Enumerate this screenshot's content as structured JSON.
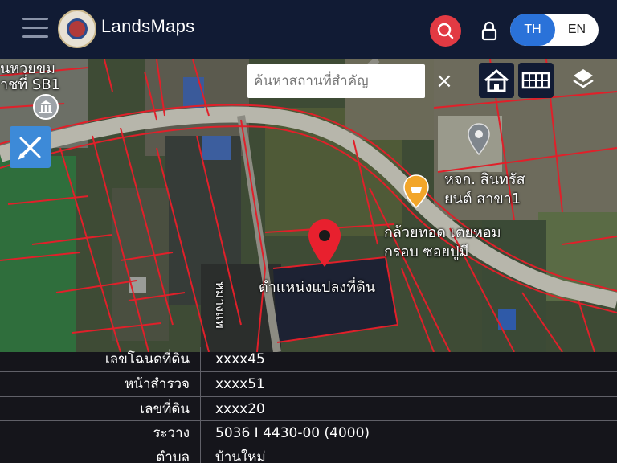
{
  "header": {
    "app_title": "LandsMaps",
    "lang_th": "TH",
    "lang_en": "EN",
    "active_lang": "TH"
  },
  "map": {
    "search_placeholder": "ค้นหาสถานที่สำคัญ",
    "search_value": "",
    "close_glyph": "×",
    "labels": {
      "top_left_line1": "นหวยขม",
      "top_left_line2": "าชที่ SB1",
      "poi_bank_line1": "หจก. สินทรัส",
      "poi_bank_line2": "ยนต์ สาขา1",
      "poi_food_line1": "กล้วยทอด เตยหอม",
      "poi_food_line2": "กรอบ ซอยปู่มี",
      "parcel_marker": "ตำแหน่งแปลงที่ดิน",
      "road_label": "หมางแพ"
    }
  },
  "parcel_info": {
    "rows": [
      {
        "label": "เลขโฉนดที่ดิน",
        "value": "xxxx45"
      },
      {
        "label": "หน้าสำรวจ",
        "value": "xxxx51"
      },
      {
        "label": "เลขที่ดิน",
        "value": "xxxx20"
      },
      {
        "label": "ระวาง",
        "value": "5036 I 4430-00 (4000)"
      },
      {
        "label": "ตำบล",
        "value": "บ้านใหม่"
      }
    ]
  },
  "colors": {
    "header_bg": "#111b34",
    "search_button": "#e23a43",
    "lang_active": "#2a72d9",
    "parcel_lines": "#e0202a",
    "marker": "#e8202e",
    "poi_orange": "#f2a62a",
    "draw_button": "#3d8ad8"
  },
  "icons": [
    "menu-icon",
    "search-icon",
    "lock-icon",
    "home-icon",
    "grid-icon",
    "layers-icon",
    "draw-tool-icon",
    "location-pin-icon",
    "food-poi-icon",
    "bank-poi-icon",
    "place-pin-icon"
  ]
}
